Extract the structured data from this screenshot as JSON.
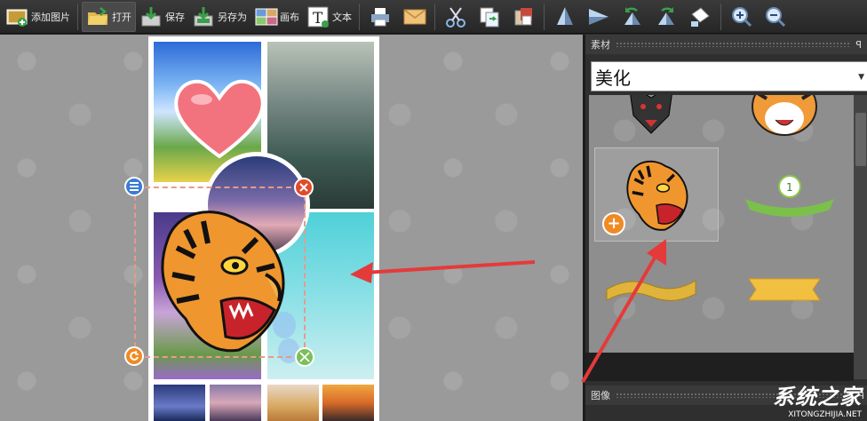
{
  "toolbar": {
    "add_image": "添加图片",
    "open": "打开",
    "save": "保存",
    "save_as": "另存为",
    "canvas": "画布",
    "text": "文本"
  },
  "panel": {
    "materials_title": "素材",
    "pin_icon": "ꟼ",
    "category_value": "美化",
    "images_title": "图像"
  },
  "watermark": {
    "main": "系统之家",
    "sub": "XITONGZHIJIA.NET"
  },
  "colors": {
    "accent_arrow": "#e53a3a",
    "handle_blue": "#3b7bd4",
    "handle_red": "#e24a2a",
    "handle_orange": "#f08a24",
    "handle_green": "#7bbf5a"
  }
}
